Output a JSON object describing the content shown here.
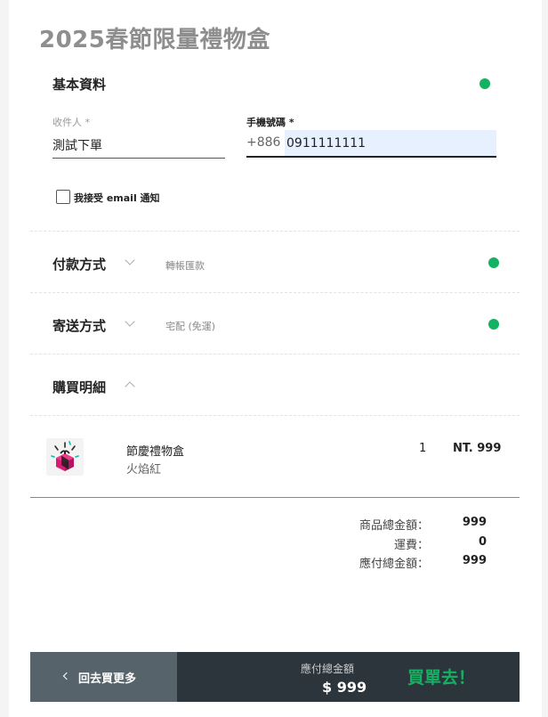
{
  "page": {
    "title": "2025春節限量禮物盒"
  },
  "basic_info": {
    "title": "基本資料",
    "status_color": "#12b262",
    "recipient_label": "收件人 *",
    "recipient_value": "測試下單",
    "phone_label": "手機號碼 *",
    "phone_prefix": "+886",
    "phone_value": "0911111111",
    "email_opt_in_label": "我接受 email 通知",
    "email_opt_in_checked": false
  },
  "payment": {
    "title": "付款方式",
    "selected": "轉帳匯款",
    "icon": "chevron-down-icon"
  },
  "shipping": {
    "title": "寄送方式",
    "selected": "宅配 (免運)",
    "icon": "chevron-down-icon"
  },
  "purchase_details": {
    "title": "購買明細",
    "icon": "chevron-up-icon",
    "items": [
      {
        "name": "節慶禮物盒",
        "variant": "火焰紅",
        "qty": "1",
        "price": "NT. 999",
        "icon": "gift-box-icon"
      }
    ],
    "summary": [
      {
        "label": "商品總金額：",
        "value": "999"
      },
      {
        "label": "運費：",
        "value": "0"
      },
      {
        "label": "應付總金額：",
        "value": "999"
      }
    ]
  },
  "footer": {
    "back_label": "回去買更多",
    "total_label": "應付總金額",
    "total_value": "$ 999",
    "checkout_label": "買單去！",
    "accent": "#12b262"
  }
}
